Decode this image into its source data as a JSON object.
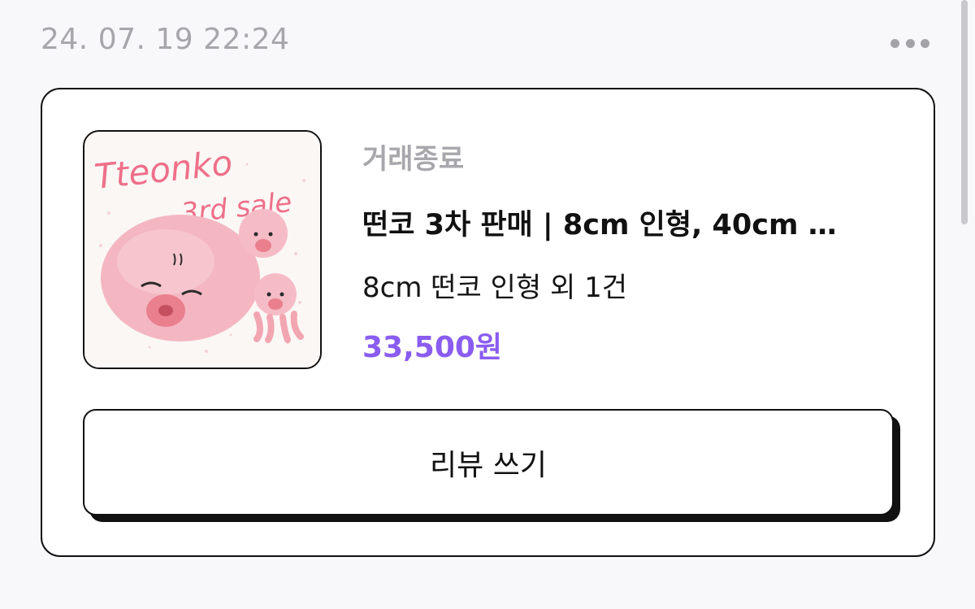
{
  "order": {
    "timestamp": "24. 07. 19 22:24",
    "more_icon": "more-horizontal-icon"
  },
  "product": {
    "image_text": "Tteonko 3rd sale",
    "status": "거래종료",
    "title": "떤코 3차 판매 | 8cm 인형, 40cm …",
    "option_summary": "8cm 떤코 인형 외 1건",
    "price": "33,500원"
  },
  "actions": {
    "review_label": "리뷰 쓰기"
  },
  "colors": {
    "price_accent": "#8a5cf0",
    "status_gray": "#a7a7ac",
    "border": "#111111"
  }
}
